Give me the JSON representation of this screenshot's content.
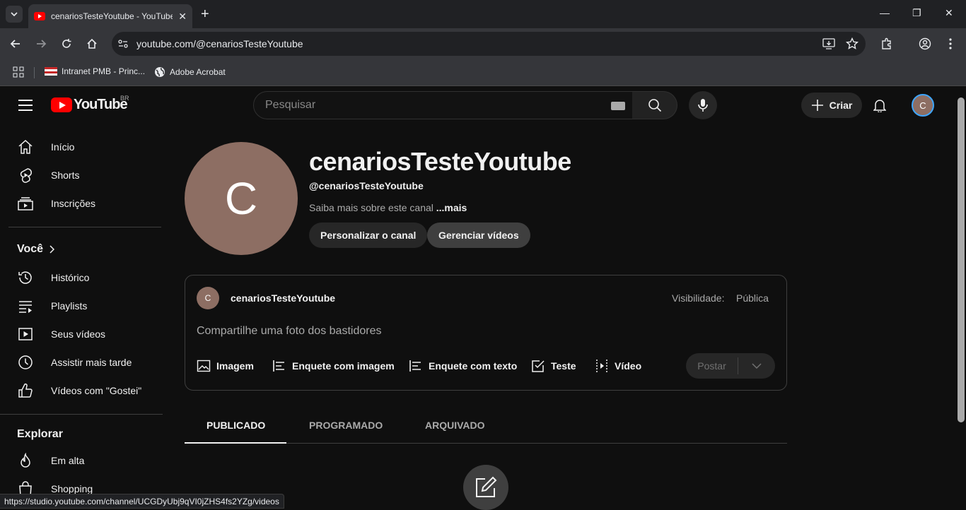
{
  "browser": {
    "tab_title": "cenariosTesteYoutube - YouTube",
    "url": "youtube.com/@cenariosTesteYoutube",
    "bookmarks": [
      {
        "label": "Intranet PMB - Princ..."
      },
      {
        "label": "Adobe Acrobat"
      }
    ],
    "status_url": "https://studio.youtube.com/channel/UCGDyUbj9qVI0jZHS4fs2YZg/videos"
  },
  "masthead": {
    "logo_text": "YouTube",
    "country_code": "BR",
    "search_placeholder": "Pesquisar",
    "create_label": "Criar",
    "avatar_letter": "C"
  },
  "sidebar": {
    "main_items": [
      {
        "label": "Início",
        "icon": "home-icon"
      },
      {
        "label": "Shorts",
        "icon": "shorts-icon"
      },
      {
        "label": "Inscrições",
        "icon": "subscriptions-icon"
      }
    ],
    "you_heading": "Você",
    "you_items": [
      {
        "label": "Histórico",
        "icon": "history-icon"
      },
      {
        "label": "Playlists",
        "icon": "playlists-icon"
      },
      {
        "label": "Seus vídeos",
        "icon": "your-videos-icon"
      },
      {
        "label": "Assistir mais tarde",
        "icon": "watch-later-icon"
      },
      {
        "label": "Vídeos com \"Gostei\"",
        "icon": "like-icon"
      }
    ],
    "explore_heading": "Explorar",
    "explore_items": [
      {
        "label": "Em alta",
        "icon": "trending-icon"
      },
      {
        "label": "Shopping",
        "icon": "shopping-icon"
      }
    ]
  },
  "channel": {
    "avatar_letter": "C",
    "name": "cenariosTesteYoutube",
    "handle": "@cenariosTesteYoutube",
    "about": "Saiba mais sobre este canal",
    "about_more": "...mais",
    "customize_label": "Personalizar o canal",
    "manage_label": "Gerenciar vídeos"
  },
  "post_composer": {
    "avatar_letter": "C",
    "author": "cenariosTesteYoutube",
    "visibility_label": "Visibilidade:",
    "visibility_value": "Pública",
    "placeholder": "Compartilhe uma foto dos bastidores",
    "actions": [
      {
        "label": "Imagem",
        "icon": "image-icon"
      },
      {
        "label": "Enquete com imagem",
        "icon": "image-poll-icon"
      },
      {
        "label": "Enquete com texto",
        "icon": "text-poll-icon"
      },
      {
        "label": "Teste",
        "icon": "quiz-icon"
      },
      {
        "label": "Vídeo",
        "icon": "video-icon"
      }
    ],
    "post_label": "Postar"
  },
  "tabs": [
    {
      "label": "PUBLICADO",
      "active": true
    },
    {
      "label": "PROGRAMADO",
      "active": false
    },
    {
      "label": "ARQUIVADO",
      "active": false
    }
  ],
  "colors": {
    "background": "#0f0f0f",
    "youtube_red": "#ff0000",
    "avatar": "#8d6e63"
  }
}
